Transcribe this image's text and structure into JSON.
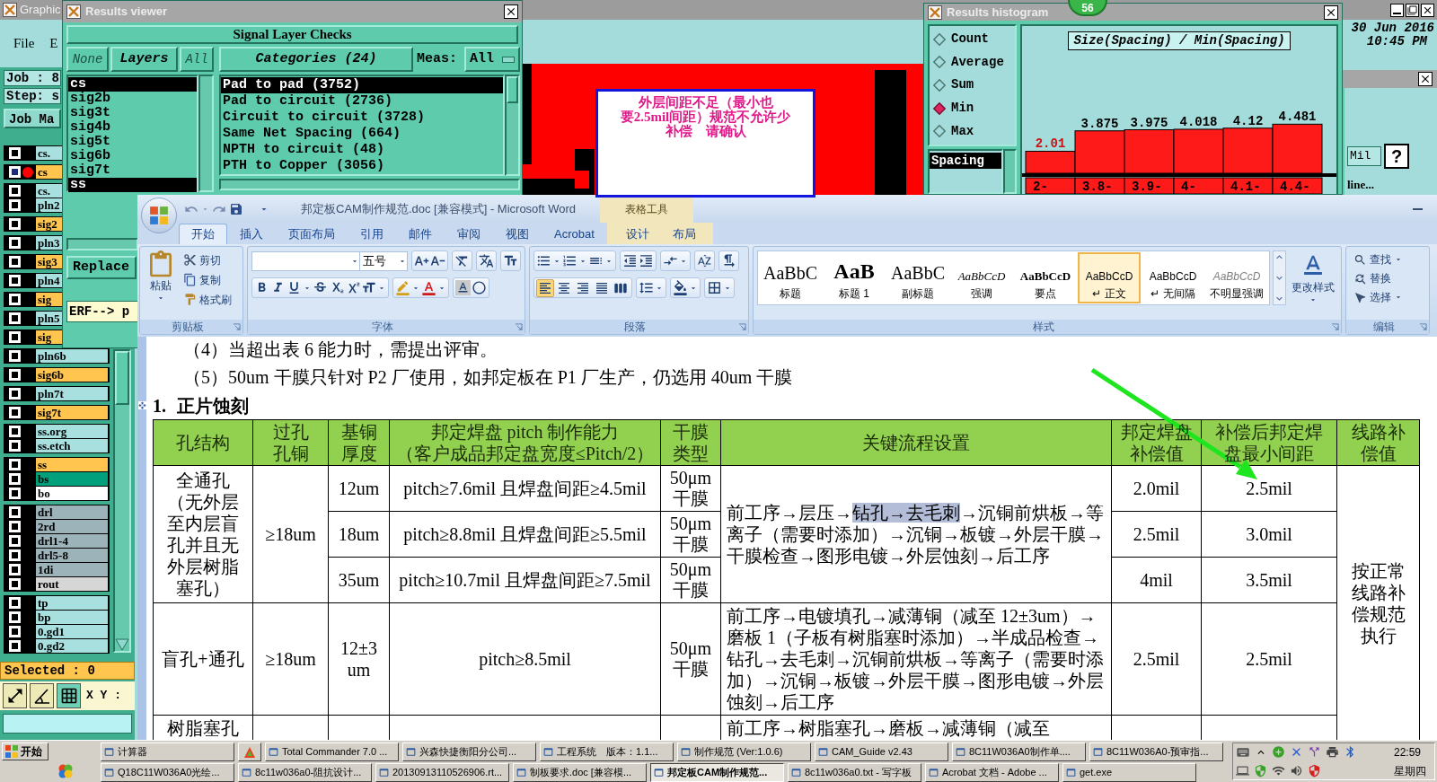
{
  "cam_window": {
    "title": "Graphic",
    "menu": [
      "File",
      "E"
    ],
    "job": "Job : 8",
    "step": "Step: s",
    "job_button": "Job Ma",
    "date": "30 Jun 2016",
    "time": "10:45 PM",
    "layer_groups": [
      {
        "layers": [
          {
            "name": "cs.",
            "color": "#a8e0e0",
            "active": false
          }
        ]
      },
      {
        "layers": [
          {
            "name": "cs",
            "color": "#ffc54f",
            "active": true
          }
        ]
      },
      {
        "layers": [
          {
            "name": "cs.",
            "color": "#a8e0e0",
            "active": false
          },
          {
            "name": "pln2",
            "color": "#a8e0e0",
            "active": false
          }
        ]
      },
      {
        "layers": [
          {
            "name": "sig2",
            "color": "#ffc54f",
            "active": false
          }
        ]
      },
      {
        "layers": [
          {
            "name": "pln3",
            "color": "#a8e0e0",
            "active": false
          }
        ]
      },
      {
        "layers": [
          {
            "name": "sig3",
            "color": "#ffc54f",
            "active": false
          }
        ]
      },
      {
        "layers": [
          {
            "name": "pln4",
            "color": "#a8e0e0",
            "active": false
          }
        ]
      },
      {
        "layers": [
          {
            "name": "sig",
            "color": "#ffc54f",
            "active": false
          }
        ]
      },
      {
        "layers": [
          {
            "name": "pln5",
            "color": "#a8e0e0",
            "active": false
          }
        ]
      },
      {
        "layers": [
          {
            "name": "sig",
            "color": "#ffc54f",
            "active": false
          }
        ]
      },
      {
        "layers": [
          {
            "name": "pln6b",
            "color": "#a8e0e0",
            "active": false
          }
        ]
      },
      {
        "layers": [
          {
            "name": "sig6b",
            "color": "#ffc54f",
            "active": false
          }
        ]
      },
      {
        "layers": [
          {
            "name": "pln7t",
            "color": "#a8e0e0",
            "active": false
          }
        ]
      },
      {
        "layers": [
          {
            "name": "sig7t",
            "color": "#ffc54f",
            "active": false
          }
        ]
      },
      {
        "layers": [
          {
            "name": "ss.org",
            "color": "#a8e0e0",
            "active": false
          },
          {
            "name": "ss.etch",
            "color": "#a8e0e0",
            "active": false
          }
        ]
      },
      {
        "layers": [
          {
            "name": "ss",
            "color": "#ffc54f",
            "active": false
          },
          {
            "name": "bs",
            "color": "#00a07c",
            "active": false
          },
          {
            "name": "bo",
            "color": "#ffffff",
            "active": false
          }
        ]
      },
      {
        "layers": [
          {
            "name": "drl",
            "color": "#9db3ba",
            "active": false
          },
          {
            "name": "2rd",
            "color": "#9db3ba",
            "active": false
          },
          {
            "name": "drl1-4",
            "color": "#9db3ba",
            "active": false
          },
          {
            "name": "drl5-8",
            "color": "#9db3ba",
            "active": false
          },
          {
            "name": "1di",
            "color": "#9db3ba",
            "active": false
          },
          {
            "name": "rout",
            "color": "#d6d6d6",
            "active": false
          }
        ]
      },
      {
        "layers": [
          {
            "name": "tp",
            "color": "#a8e0e0",
            "active": false
          },
          {
            "name": "bp",
            "color": "#a8e0e0",
            "active": false
          },
          {
            "name": "0.gd1",
            "color": "#a8e0e0",
            "active": false
          },
          {
            "name": "0.gd2",
            "color": "#a8e0e0",
            "active": false
          }
        ]
      }
    ],
    "selected_count": "Selected : 0",
    "coordinates_label": "X Y :",
    "units_field": "Mil",
    "help_button": "?",
    "panel_text": "line..."
  },
  "results_viewer": {
    "title": "Results viewer",
    "heading": "Signal Layer Checks",
    "none_button": "None",
    "layers_button": "Layers",
    "all_button": "All",
    "categories_button": "Categories (24)",
    "meas_label": "Meas:",
    "meas_value": "All",
    "layers": [
      {
        "name": "cs",
        "selected": true
      },
      {
        "name": "sig2b",
        "selected": false
      },
      {
        "name": "sig3t",
        "selected": false
      },
      {
        "name": "sig4b",
        "selected": false
      },
      {
        "name": "sig5t",
        "selected": false
      },
      {
        "name": "sig6b",
        "selected": false
      },
      {
        "name": "sig7t",
        "selected": false
      },
      {
        "name": "ss",
        "selected": true
      }
    ],
    "categories": [
      {
        "name": "Pad to pad (3752)",
        "selected": true
      },
      {
        "name": "Pad to circuit (2736)",
        "selected": false
      },
      {
        "name": "Circuit to circuit (3728)",
        "selected": false
      },
      {
        "name": "Same Net Spacing (664)",
        "selected": false
      },
      {
        "name": "NPTH to circuit (48)",
        "selected": false
      },
      {
        "name": "PTH to Copper (3056)",
        "selected": false
      }
    ],
    "replace_button": "Replace",
    "command_field": "ERF--> p"
  },
  "annotation": {
    "lines": [
      "外层间距不足（最小也",
      "要2.5mil间距）规范不允许少",
      "补偿　请确认"
    ]
  },
  "histogram": {
    "title": "Results histogram",
    "modes": [
      {
        "label": "Count",
        "selected": false
      },
      {
        "label": "Average",
        "selected": false
      },
      {
        "label": "Sum",
        "selected": false
      },
      {
        "label": "Min",
        "selected": true
      },
      {
        "label": "Max",
        "selected": false
      }
    ],
    "fields": [
      {
        "label": "Spacing",
        "selected": true
      }
    ],
    "chart_data": {
      "type": "bar",
      "title": "Size(Spacing) / Min(Spacing)",
      "categories": [
        "2-",
        "3.8-",
        "3.9-",
        "4-",
        "4.1-",
        "4.4-"
      ],
      "values": [
        2.01,
        3.875,
        3.975,
        4.018,
        4.12,
        4.481
      ],
      "data_labels": true
    }
  },
  "badge": "56",
  "word": {
    "title": "邦定板CAM制作规范.doc [兼容模式] - Microsoft Word",
    "context_group": "表格工具",
    "tabs": [
      {
        "label": "开始",
        "selected": true
      },
      {
        "label": "插入",
        "selected": false
      },
      {
        "label": "页面布局",
        "selected": false
      },
      {
        "label": "引用",
        "selected": false
      },
      {
        "label": "邮件",
        "selected": false
      },
      {
        "label": "审阅",
        "selected": false
      },
      {
        "label": "视图",
        "selected": false
      },
      {
        "label": "Acrobat",
        "selected": false
      }
    ],
    "context_tabs": [
      {
        "label": "设计",
        "selected": false
      },
      {
        "label": "布局",
        "selected": false
      }
    ],
    "clipboard": {
      "label": "剪贴板",
      "paste": "粘贴",
      "cut": "剪切",
      "copy": "复制",
      "format_painter": "格式刷"
    },
    "font": {
      "label": "字体",
      "size": "五号"
    },
    "paragraph": {
      "label": "段落",
      "alignment": [
        {
          "kind": "left",
          "selected": true
        },
        {
          "kind": "center",
          "selected": false
        },
        {
          "kind": "right",
          "selected": false
        },
        {
          "kind": "justify",
          "selected": false
        },
        {
          "kind": "distributed",
          "selected": false
        }
      ]
    },
    "styles": {
      "label": "样式",
      "items": [
        {
          "sample": "AaBbC",
          "name": "标题",
          "kind": "title",
          "selected": false
        },
        {
          "sample": "AaB",
          "name": "标题 1",
          "kind": "heading1",
          "selected": false
        },
        {
          "sample": "AaBbC",
          "name": "副标题",
          "kind": "subtitle",
          "selected": false
        },
        {
          "sample": "AaBbCcD",
          "name": "强调",
          "kind": "emphasis",
          "selected": false
        },
        {
          "sample": "AaBbCcD",
          "name": "要点",
          "kind": "strong",
          "selected": false
        },
        {
          "sample": "AaBbCcD",
          "name": "↵ 正文",
          "kind": "normal",
          "selected": true
        },
        {
          "sample": "AaBbCcD",
          "name": "↵ 无间隔",
          "kind": "no_spacing",
          "selected": false
        },
        {
          "sample": "AaBbCcD",
          "name": "不明显强调",
          "kind": "subtle_emphasis",
          "selected": false
        }
      ],
      "change_styles": "更改样式"
    },
    "editing": {
      "label": "编辑",
      "find": "查找",
      "replace": "替换",
      "select": "选择"
    },
    "document": {
      "paragraphs": [
        "（4）当超出表 6 能力时，需提出评审。",
        "（5）50um 干膜只针对 P2 厂使用，如邦定板在 P1 厂生产，仍选用 40um 干膜"
      ],
      "heading": {
        "number": "1.",
        "text": "正片蚀刻"
      },
      "table": {
        "columns": [
          [
            "孔结构"
          ],
          [
            "过孔孔铜"
          ],
          [
            "基铜厚度"
          ],
          [
            "邦定焊盘 pitch 制作能力",
            "（客户成品邦定盘宽度≤Pitch/2）"
          ],
          [
            "干膜类型"
          ],
          [
            "关键流程设置"
          ],
          [
            "邦定焊盘补偿值"
          ],
          [
            "补偿后邦定焊盘最小间距"
          ],
          [
            "线路补偿值"
          ]
        ],
        "rows": [
          {
            "structure": [
              "全通孔",
              "（无外层至内层盲孔并且无外层树脂塞孔）"
            ],
            "via_copper": "≥18um",
            "process": [
              {
                "text": "前工序→层压→",
                "highlighted": false
              },
              {
                "text": "钻孔→去毛刺",
                "highlighted": true
              },
              {
                "text": "→沉铜前烘板→等离子（需要时添加）→沉铜→板镀→外层干膜→干膜检查→图形电镀→外层蚀刻→后工序",
                "highlighted": false
              }
            ],
            "variants": [
              {
                "base_copper": "12um",
                "pitch": "pitch≥7.6mil 且焊盘间距≥4.5mil",
                "dry_film": [
                  "50μm",
                  "干膜"
                ],
                "pad_compensation": "2.0mil",
                "min_spacing": "2.5mil"
              },
              {
                "base_copper": "18um",
                "pitch": "pitch≥8.8mil 且焊盘间距≥5.5mil",
                "dry_film": [
                  "50μm",
                  "干膜"
                ],
                "pad_compensation": "2.5mil",
                "min_spacing": "3.0mil"
              },
              {
                "base_copper": "35um",
                "pitch": "pitch≥10.7mil 且焊盘间距≥7.5mil",
                "dry_film": [
                  "50μm",
                  "干膜"
                ],
                "pad_compensation": "4mil",
                "min_spacing": "3.5mil"
              }
            ]
          },
          {
            "structure": [
              "盲孔+通孔"
            ],
            "via_copper": "≥18um",
            "process": [
              {
                "text": "前工序→电镀填孔→减薄铜（减至 12±3um）→磨板 1（子板有树脂塞时添加）→半成品检查→钻孔→去毛刺→沉铜前烘板→等离子（需要时添加）→沉铜→板镀→外层干膜→图形电镀→外层蚀刻→后工序",
                "highlighted": false
              }
            ],
            "variants": [
              {
                "base_copper": "12±3 um",
                "pitch": "pitch≥8.5mil",
                "dry_film": [
                  "50μm",
                  "干膜"
                ],
                "pad_compensation": "2.5mil",
                "min_spacing": "2.5mil"
              }
            ]
          },
          {
            "structure": [
              "树脂塞孔"
            ],
            "process": [
              {
                "text": "前工序→树脂塞孔→磨板→减薄铜（减至",
                "highlighted": false
              }
            ]
          }
        ],
        "line_compensation": "按正常线路补偿规范执行"
      }
    }
  },
  "taskbar": {
    "start": "开始",
    "tasks": [
      {
        "kind": "task",
        "label": "计算器",
        "selected": false
      },
      {
        "kind": "icon",
        "selected": false
      },
      {
        "kind": "task",
        "label": "Total Commander 7.0 ...",
        "selected": false
      },
      {
        "kind": "task",
        "label": "兴森快捷衡阳分公司...",
        "selected": false
      },
      {
        "kind": "task",
        "label": "工程系统　版本：1.1...",
        "selected": false
      },
      {
        "kind": "task",
        "label": "制作规范 (Ver:1.0.6)",
        "selected": false
      },
      {
        "kind": "task",
        "label": "CAM_Guide v2.43",
        "selected": false
      },
      {
        "kind": "task",
        "label": "8C11W036A0制作单....",
        "selected": false
      },
      {
        "kind": "task",
        "label": "8C11W036A0-预审指...",
        "selected": false
      },
      {
        "kind": "task",
        "label": "Q18C11W036A0光绘...",
        "selected": false
      },
      {
        "kind": "task",
        "label": "8c11w036a0-阻抗设计...",
        "selected": false
      },
      {
        "kind": "task",
        "label": "20130913110526906.rt...",
        "selected": false
      },
      {
        "kind": "task",
        "label": "制板要求.doc [兼容模...",
        "selected": false
      },
      {
        "kind": "task",
        "label": "邦定板CAM制作规范...",
        "selected": true
      },
      {
        "kind": "task",
        "label": "8c11w036a0.txt - 写字板",
        "selected": false
      },
      {
        "kind": "task",
        "label": "Acrobat 文档 - Adobe ...",
        "selected": false
      },
      {
        "kind": "task",
        "label": "get.exe",
        "selected": false
      }
    ],
    "clock": "22:59",
    "day": "星期四"
  }
}
